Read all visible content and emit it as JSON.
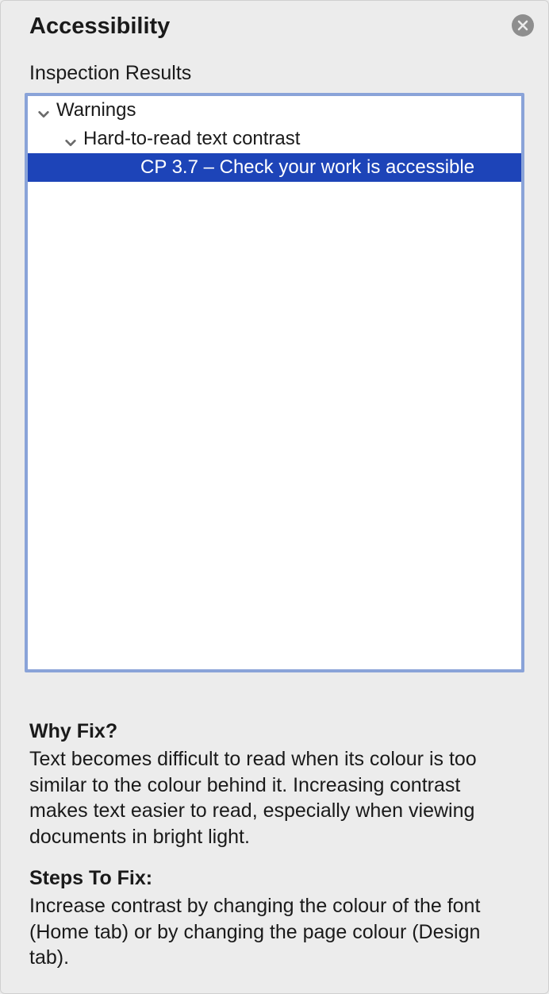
{
  "header": {
    "title": "Accessibility"
  },
  "inspection": {
    "label": "Inspection Results",
    "tree": {
      "warnings_label": "Warnings",
      "category_label": "Hard-to-read text contrast",
      "item_label": "CP 3.7 – Check your work is accessible"
    }
  },
  "details": {
    "why_heading": "Why Fix?",
    "why_body": "Text becomes difficult to read when its colour is too similar to the colour behind it. Increasing contrast makes text easier to read, especially when viewing documents in bright light.",
    "steps_heading": "Steps To Fix:",
    "steps_body": "Increase contrast by changing the colour of the font (Home tab) or by changing the page colour (Design tab)."
  }
}
